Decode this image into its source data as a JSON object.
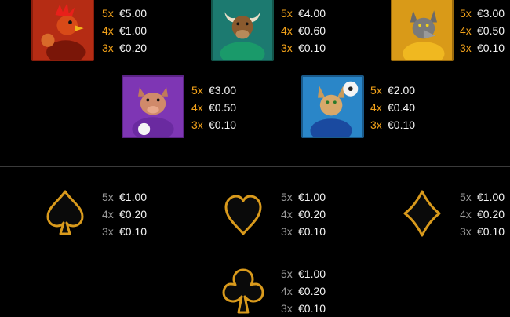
{
  "premium_symbols": [
    {
      "name": "rooster",
      "colors": {
        "bg": "#c8341a",
        "border": "#8a1e0c"
      },
      "pays": [
        {
          "mult": "5x",
          "amount": "€5.00"
        },
        {
          "mult": "4x",
          "amount": "€1.00"
        },
        {
          "mult": "3x",
          "amount": "€0.20"
        }
      ]
    },
    {
      "name": "bull",
      "colors": {
        "bg": "#1f8a7c",
        "border": "#13564c"
      },
      "pays": [
        {
          "mult": "5x",
          "amount": "€4.00"
        },
        {
          "mult": "4x",
          "amount": "€0.60"
        },
        {
          "mult": "3x",
          "amount": "€0.10"
        }
      ]
    },
    {
      "name": "wolf",
      "colors": {
        "bg": "#e0a21a",
        "border": "#9a6a0c"
      },
      "pays": [
        {
          "mult": "5x",
          "amount": "€3.00"
        },
        {
          "mult": "4x",
          "amount": "€0.50"
        },
        {
          "mult": "3x",
          "amount": "€0.10"
        }
      ]
    },
    {
      "name": "boar",
      "colors": {
        "bg": "#8a3fc0",
        "border": "#5b2386"
      },
      "pays": [
        {
          "mult": "5x",
          "amount": "€3.00"
        },
        {
          "mult": "4x",
          "amount": "€0.50"
        },
        {
          "mult": "3x",
          "amount": "€0.10"
        }
      ]
    },
    {
      "name": "lynx",
      "colors": {
        "bg": "#2f8fd0",
        "border": "#1a5a8a"
      },
      "pays": [
        {
          "mult": "5x",
          "amount": "€2.00"
        },
        {
          "mult": "4x",
          "amount": "€0.40"
        },
        {
          "mult": "3x",
          "amount": "€0.10"
        }
      ]
    }
  ],
  "card_symbols": [
    {
      "name": "spade",
      "icon": "spade-icon",
      "pays": [
        {
          "mult": "5x",
          "amount": "€1.00"
        },
        {
          "mult": "4x",
          "amount": "€0.20"
        },
        {
          "mult": "3x",
          "amount": "€0.10"
        }
      ]
    },
    {
      "name": "heart",
      "icon": "heart-icon",
      "pays": [
        {
          "mult": "5x",
          "amount": "€1.00"
        },
        {
          "mult": "4x",
          "amount": "€0.20"
        },
        {
          "mult": "3x",
          "amount": "€0.10"
        }
      ]
    },
    {
      "name": "diamond",
      "icon": "diamond-icon",
      "pays": [
        {
          "mult": "5x",
          "amount": "€1.00"
        },
        {
          "mult": "4x",
          "amount": "€0.20"
        },
        {
          "mult": "3x",
          "amount": "€0.10"
        }
      ]
    },
    {
      "name": "club",
      "icon": "club-icon",
      "pays": [
        {
          "mult": "5x",
          "amount": "€1.00"
        },
        {
          "mult": "4x",
          "amount": "€0.20"
        },
        {
          "mult": "3x",
          "amount": "€0.10"
        }
      ]
    }
  ],
  "colors": {
    "gold_multiplier": "#f2a21a",
    "grey_multiplier": "#9a9a9a",
    "suit_gold": "#d99a1c",
    "suit_fill": "#0a0a0a"
  }
}
